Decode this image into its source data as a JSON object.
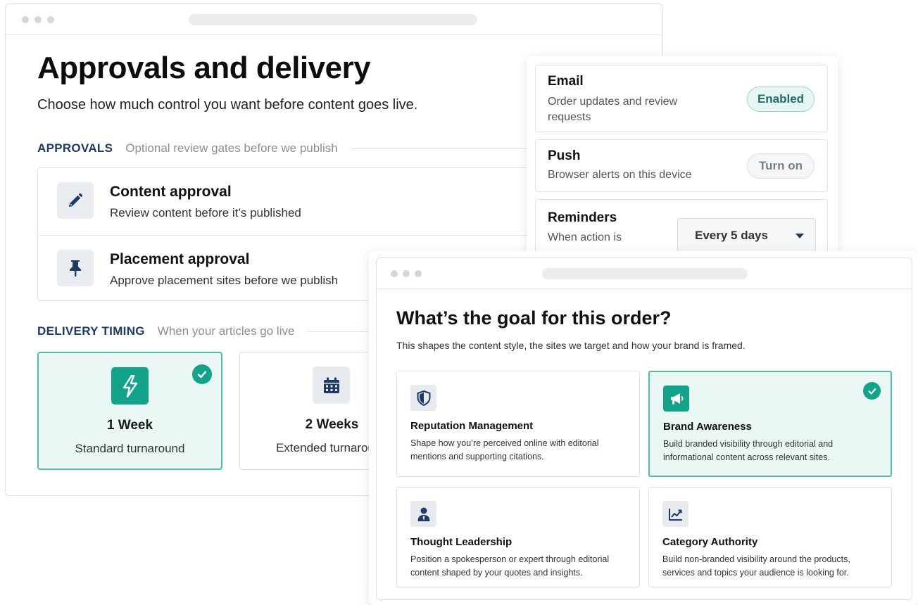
{
  "approvals_window": {
    "title": "Approvals and delivery",
    "subtitle": "Choose how much control you want before content goes live.",
    "approvals_section": {
      "label": "APPROVALS",
      "description": "Optional review gates before we publish",
      "items": [
        {
          "title": "Content approval",
          "description": "Review content before it’s published",
          "icon": "pencil-icon"
        },
        {
          "title": "Placement approval",
          "description": "Approve placement sites before we publish",
          "icon": "pin-icon"
        }
      ]
    },
    "delivery_section": {
      "label": "DELIVERY TIMING",
      "description": "When your articles go live",
      "options": [
        {
          "title": "1 Week",
          "description": "Standard turnaround",
          "icon": "lightning-icon",
          "selected": true
        },
        {
          "title": "2 Weeks",
          "description": "Extended turnaround",
          "icon": "calendar-icon",
          "selected": false
        }
      ]
    }
  },
  "notifications": {
    "email": {
      "title": "Email",
      "description": "Order updates and review requests",
      "action_label": "Enabled"
    },
    "push": {
      "title": "Push",
      "description": "Browser alerts on this device",
      "action_label": "Turn on"
    },
    "reminders": {
      "title": "Reminders",
      "description": "When action is",
      "selected_value": "Every 5 days"
    }
  },
  "goal_window": {
    "title": "What’s the goal for this order?",
    "subtitle": "This shapes the content style, the sites we target and how your brand is framed.",
    "goals": [
      {
        "title": "Reputation Management",
        "description": "Shape how you’re perceived online with editorial mentions and supporting citations.",
        "icon": "shield-icon",
        "selected": false
      },
      {
        "title": "Brand Awareness",
        "description": "Build branded visibility through editorial and informational content across relevant sites.",
        "icon": "megaphone-icon",
        "selected": true
      },
      {
        "title": "Thought Leadership",
        "description": "Position a spokesperson or expert through editorial content shaped by your quotes and insights.",
        "icon": "person-icon",
        "selected": false
      },
      {
        "title": "Category Authority",
        "description": "Build non-branded visibility around the products, services and topics your audience is looking for.",
        "icon": "line-chart-icon",
        "selected": false
      }
    ]
  },
  "colors": {
    "accent_green": "#12a38a",
    "selected_bg": "#eaf7f4",
    "navy": "#1d3b66"
  }
}
